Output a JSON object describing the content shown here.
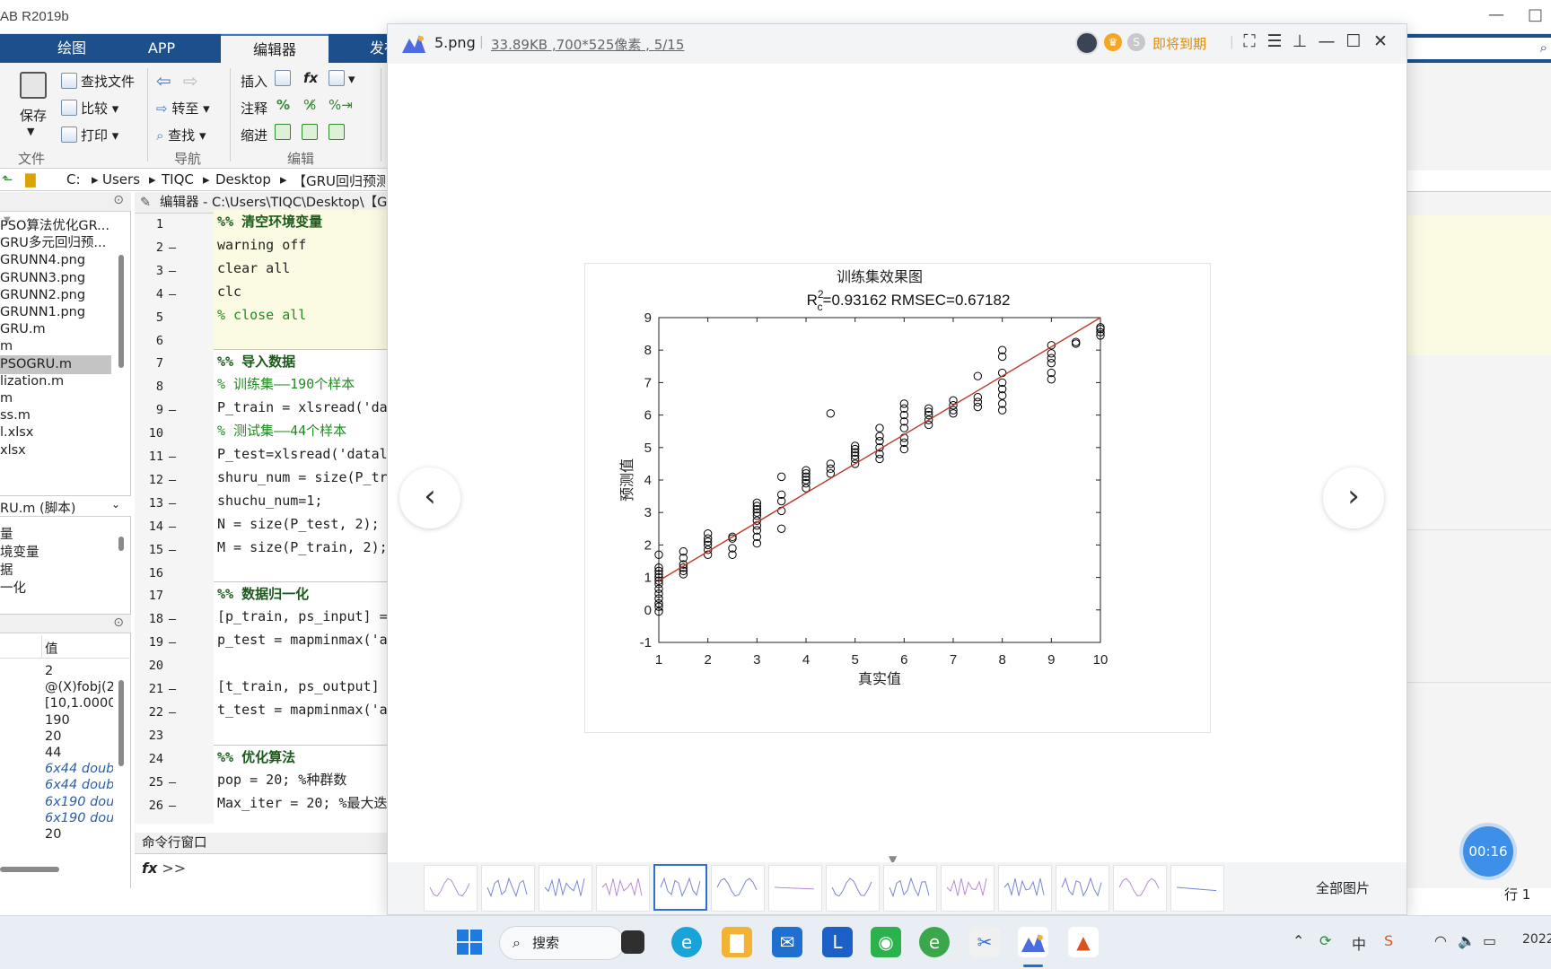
{
  "matlab": {
    "title": "AB R2019b",
    "tabs": [
      "绘图",
      "APP",
      "编辑器",
      "发布"
    ],
    "active_tab": "编辑器",
    "ribbon": {
      "file_group": "文件",
      "nav_group": "导航",
      "edit_group": "编辑",
      "find_file": "查找文件",
      "compare": "比较",
      "print": "打印",
      "save": "保存",
      "goto": "转至",
      "find": "查找",
      "insert": "插入",
      "comment": "注释",
      "indent": "缩进",
      "fx": "fx"
    },
    "address": [
      "C:",
      "Users",
      "TIQC",
      "Desktop",
      "【GRU回归预测"
    ],
    "files": [
      "PSO算法优化GR...",
      "GRU多元回归预...",
      "GRUNN4.png",
      "GRUNN3.png",
      "GRUNN2.png",
      "GRUNN1.png",
      "GRU.m",
      "m",
      "PSOGRU.m",
      "lization.m",
      "m",
      "ss.m",
      "l.xlsx",
      "xlsx"
    ],
    "selected_file": "PSOGRU.m",
    "detail_label": "RU.m (脚本)",
    "outline": [
      "量",
      "境变量",
      "据",
      "一化"
    ],
    "workspace_value_header": "值",
    "workspace_values": [
      "2",
      "@(X)fobj(2",
      "[10,1.0000",
      "190",
      "20",
      "44",
      "6x44 doub",
      "6x44 doub",
      "6x190 dou",
      "6x190 dou",
      "20"
    ],
    "editor_title": "编辑器 - C:\\Users\\TIQC\\Desktop\\【G",
    "code_lines": [
      {
        "n": "1",
        "dash": "",
        "text": "%%  清空环境变量",
        "cls": "sec hl"
      },
      {
        "n": "2",
        "dash": "—",
        "text": "warning off",
        "cls": "hl"
      },
      {
        "n": "3",
        "dash": "—",
        "text": "clear  all",
        "cls": "hl"
      },
      {
        "n": "4",
        "dash": "—",
        "text": "clc",
        "cls": "hl"
      },
      {
        "n": "5",
        "dash": "",
        "text": "% close all",
        "cls": "cm hl"
      },
      {
        "n": "6",
        "dash": "",
        "text": "",
        "cls": "hl"
      },
      {
        "n": "7",
        "dash": "",
        "text": "%%  导入数据",
        "cls": "sec cellsep"
      },
      {
        "n": "8",
        "dash": "",
        "text": "% 训练集——190个样本",
        "cls": "cm"
      },
      {
        "n": "9",
        "dash": "—",
        "text": "P_train = xlsread('dat",
        "cls": ""
      },
      {
        "n": "10",
        "dash": "",
        "text": "% 测试集——44个样本",
        "cls": "cm"
      },
      {
        "n": "11",
        "dash": "—",
        "text": "P_test=xlsread('datal",
        "cls": ""
      },
      {
        "n": "12",
        "dash": "—",
        "text": "shuru_num = size(P_tra",
        "cls": ""
      },
      {
        "n": "13",
        "dash": "—",
        "text": "shuchu_num=1;",
        "cls": ""
      },
      {
        "n": "14",
        "dash": "—",
        "text": "N = size(P_test, 2);",
        "cls": ""
      },
      {
        "n": "15",
        "dash": "—",
        "text": "M = size(P_train, 2);",
        "cls": ""
      },
      {
        "n": "16",
        "dash": "",
        "text": "",
        "cls": ""
      },
      {
        "n": "17",
        "dash": "",
        "text": "%%  数据归一化",
        "cls": "sec cellsep"
      },
      {
        "n": "18",
        "dash": "—",
        "text": "[p_train, ps_input] =",
        "cls": ""
      },
      {
        "n": "19",
        "dash": "—",
        "text": "p_test = mapminmax('ap",
        "cls": ""
      },
      {
        "n": "20",
        "dash": "",
        "text": "",
        "cls": ""
      },
      {
        "n": "21",
        "dash": "—",
        "text": "[t_train, ps_output] =",
        "cls": ""
      },
      {
        "n": "22",
        "dash": "—",
        "text": "t_test = mapminmax('ap",
        "cls": ""
      },
      {
        "n": "23",
        "dash": "",
        "text": "",
        "cls": ""
      },
      {
        "n": "24",
        "dash": "",
        "text": "%% 优化算法",
        "cls": "sec cellsep"
      },
      {
        "n": "25",
        "dash": "—",
        "text": "pop = 20;       %种群数",
        "cls": ""
      },
      {
        "n": "26",
        "dash": "—",
        "text": "Max_iter = 20;  %最大迭",
        "cls": ""
      }
    ],
    "command_window": "命令行窗口",
    "prompt": ">>",
    "row_indicator": "行  1"
  },
  "viewer": {
    "filename": "5.png",
    "filesize": "33.89KB",
    "dimensions": "700*525像素",
    "page": "5/15",
    "expire": "即将到期",
    "all_images": "全部图片",
    "timer": "00:16",
    "thumb_count": 14,
    "active_thumb": 4
  },
  "taskbar": {
    "search": "搜索",
    "clock": "2022"
  },
  "chart_data": {
    "type": "scatter",
    "title": "训练集效果图",
    "subtitle": "R²c=0.93162  RMSEC=0.67182",
    "xlabel": "真实值",
    "ylabel": "预测值",
    "xlim": [
      1,
      10
    ],
    "ylim": [
      -1,
      9
    ],
    "xticks": [
      1,
      2,
      3,
      4,
      5,
      6,
      7,
      8,
      9,
      10
    ],
    "yticks": [
      -1,
      0,
      1,
      2,
      3,
      4,
      5,
      6,
      7,
      8,
      9
    ],
    "grid": false,
    "fit_line": {
      "x": [
        1,
        10
      ],
      "y": [
        0.9,
        9.0
      ],
      "color": "#c0392b"
    },
    "marker_color": "#000000",
    "points": [
      [
        1,
        -0.05
      ],
      [
        1,
        0.1
      ],
      [
        1,
        0.2
      ],
      [
        1,
        0.35
      ],
      [
        1,
        0.5
      ],
      [
        1,
        0.65
      ],
      [
        1,
        0.8
      ],
      [
        1,
        0.9
      ],
      [
        1,
        1.0
      ],
      [
        1,
        1.1
      ],
      [
        1,
        1.2
      ],
      [
        1,
        1.3
      ],
      [
        1,
        1.7
      ],
      [
        1.5,
        1.1
      ],
      [
        1.5,
        1.2
      ],
      [
        1.5,
        1.3
      ],
      [
        1.5,
        1.4
      ],
      [
        1.5,
        1.6
      ],
      [
        1.5,
        1.8
      ],
      [
        2,
        1.7
      ],
      [
        2,
        1.85
      ],
      [
        2,
        2.0
      ],
      [
        2,
        2.1
      ],
      [
        2,
        2.2
      ],
      [
        2,
        2.35
      ],
      [
        2.5,
        1.7
      ],
      [
        2.5,
        1.9
      ],
      [
        2.5,
        2.2
      ],
      [
        2.5,
        2.25
      ],
      [
        3,
        2.05
      ],
      [
        3,
        2.25
      ],
      [
        3,
        2.45
      ],
      [
        3,
        2.6
      ],
      [
        3,
        2.75
      ],
      [
        3,
        2.9
      ],
      [
        3,
        3.0
      ],
      [
        3,
        3.1
      ],
      [
        3,
        3.2
      ],
      [
        3,
        3.3
      ],
      [
        3.5,
        2.5
      ],
      [
        3.5,
        3.05
      ],
      [
        3.5,
        3.35
      ],
      [
        3.5,
        3.55
      ],
      [
        3.5,
        4.1
      ],
      [
        4,
        3.75
      ],
      [
        4,
        3.9
      ],
      [
        4,
        4.0
      ],
      [
        4,
        4.1
      ],
      [
        4,
        4.2
      ],
      [
        4,
        4.3
      ],
      [
        4.5,
        4.2
      ],
      [
        4.5,
        4.35
      ],
      [
        4.5,
        4.5
      ],
      [
        4.5,
        6.05
      ],
      [
        5,
        4.5
      ],
      [
        5,
        4.65
      ],
      [
        5,
        4.75
      ],
      [
        5,
        4.85
      ],
      [
        5,
        4.95
      ],
      [
        5,
        5.05
      ],
      [
        5.5,
        4.65
      ],
      [
        5.5,
        4.8
      ],
      [
        5.5,
        5.0
      ],
      [
        5.5,
        5.2
      ],
      [
        5.5,
        5.35
      ],
      [
        5.5,
        5.6
      ],
      [
        6,
        4.95
      ],
      [
        6,
        5.15
      ],
      [
        6,
        5.3
      ],
      [
        6,
        5.6
      ],
      [
        6,
        5.8
      ],
      [
        6,
        6.0
      ],
      [
        6,
        6.2
      ],
      [
        6,
        6.35
      ],
      [
        6.5,
        5.7
      ],
      [
        6.5,
        5.85
      ],
      [
        6.5,
        6.0
      ],
      [
        6.5,
        6.1
      ],
      [
        6.5,
        6.2
      ],
      [
        7,
        6.05
      ],
      [
        7,
        6.15
      ],
      [
        7,
        6.3
      ],
      [
        7,
        6.45
      ],
      [
        7.5,
        6.25
      ],
      [
        7.5,
        6.4
      ],
      [
        7.5,
        6.55
      ],
      [
        7.5,
        7.2
      ],
      [
        8,
        6.15
      ],
      [
        8,
        6.35
      ],
      [
        8,
        6.6
      ],
      [
        8,
        6.8
      ],
      [
        8,
        7.0
      ],
      [
        8,
        7.3
      ],
      [
        8,
        7.8
      ],
      [
        8,
        8.0
      ],
      [
        9,
        7.1
      ],
      [
        9,
        7.3
      ],
      [
        9,
        7.6
      ],
      [
        9,
        7.75
      ],
      [
        9,
        7.9
      ],
      [
        9,
        8.15
      ],
      [
        9.5,
        8.2
      ],
      [
        9.5,
        8.25
      ],
      [
        10,
        8.45
      ],
      [
        10,
        8.55
      ],
      [
        10,
        8.65
      ],
      [
        10,
        8.7
      ]
    ]
  }
}
